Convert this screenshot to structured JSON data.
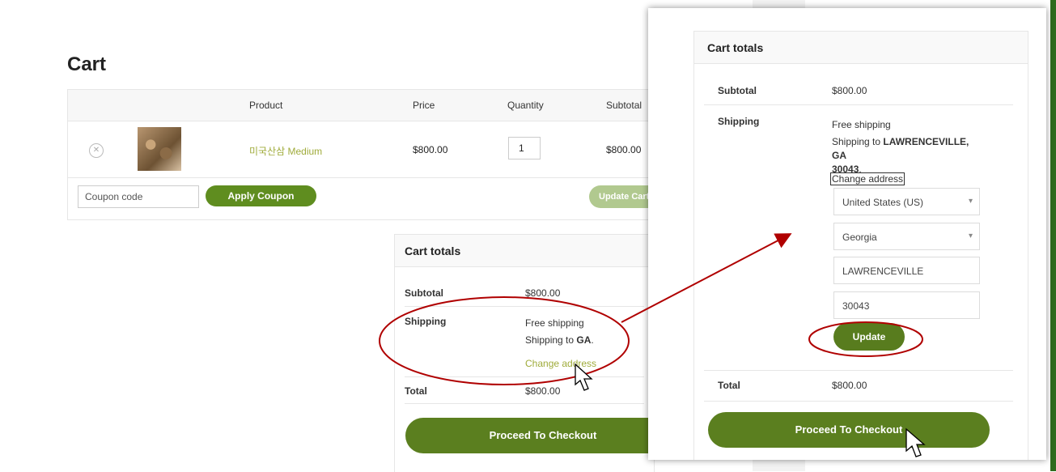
{
  "cart": {
    "title": "Cart",
    "headers": {
      "product": "Product",
      "price": "Price",
      "quantity": "Quantity",
      "subtotal": "Subtotal"
    },
    "item": {
      "remove_icon": "close-icon",
      "name": "미국산삼 Medium",
      "price": "$800.00",
      "quantity": "1",
      "subtotal": "$800.00"
    },
    "coupon_placeholder": "Coupon code",
    "apply_coupon_label": "Apply Coupon",
    "update_cart_label": "Update Cart"
  },
  "totals_main": {
    "title": "Cart totals",
    "subtotal_label": "Subtotal",
    "subtotal_value": "$800.00",
    "shipping_label": "Shipping",
    "shipping_method": "Free shipping",
    "shipping_to_prefix": "Shipping to ",
    "shipping_to_value": "GA",
    "shipping_to_suffix": ".",
    "change_address": "Change address",
    "total_label": "Total",
    "total_value": "$800.00",
    "checkout_label": "Proceed To Checkout"
  },
  "totals_zoom": {
    "title": "Cart totals",
    "subtotal_label": "Subtotal",
    "subtotal_value": "$800.00",
    "shipping_label": "Shipping",
    "shipping_method": "Free shipping",
    "shipping_to_prefix": "Shipping to ",
    "shipping_to_value_line1": "LAWRENCEVILLE, GA",
    "shipping_to_value_line2": "30043",
    "shipping_to_suffix": ".",
    "change_address": "Change address",
    "country": "United States (US)",
    "state": "Georgia",
    "city": "LAWRENCEVILLE",
    "zip": "30043",
    "update_label": "Update",
    "total_label": "Total",
    "total_value": "$800.00",
    "checkout_label": "Proceed To Checkout"
  },
  "colors": {
    "accent_green": "#5f8d1f",
    "link_olive": "#9fab3a",
    "annotation_red": "#b00000"
  }
}
